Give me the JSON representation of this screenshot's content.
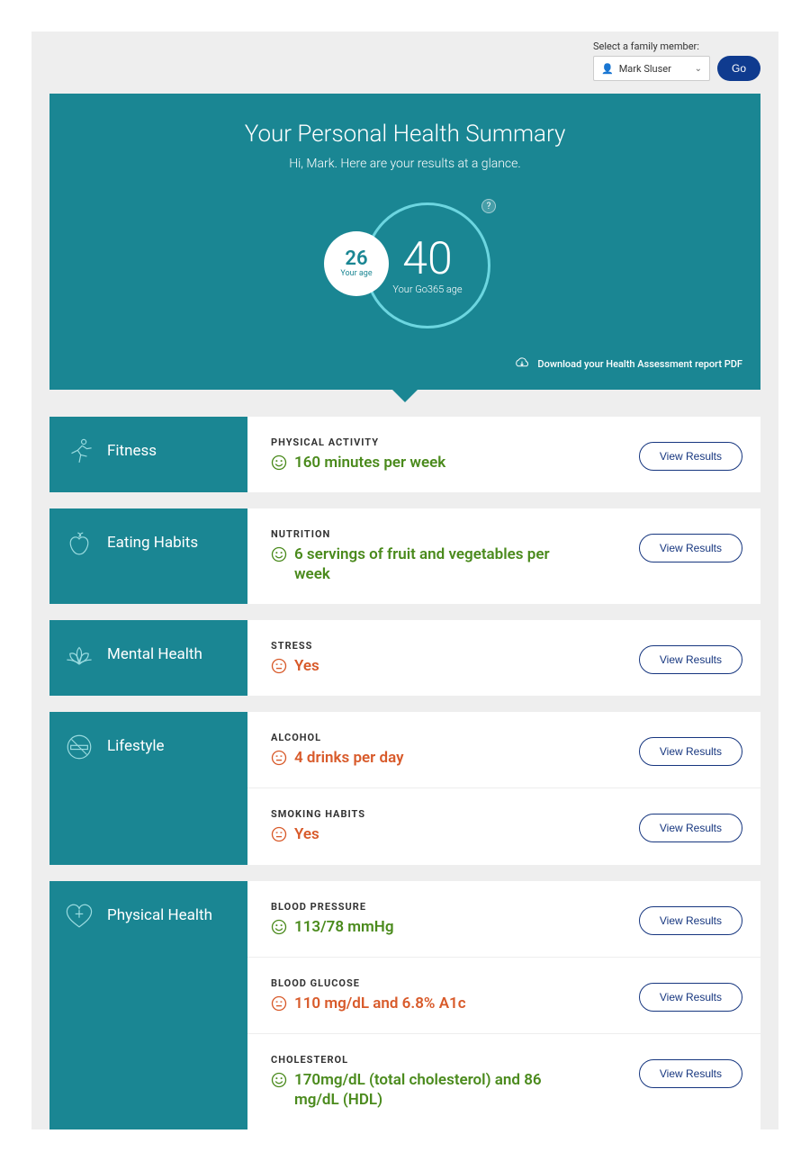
{
  "family": {
    "label": "Select a family member:",
    "selected": "Mark Sluser",
    "go_label": "Go"
  },
  "hero": {
    "title": "Your Personal Health Summary",
    "subtitle": "Hi, Mark. Here are your results at a glance.",
    "your_age_value": "26",
    "your_age_label": "Your age",
    "go365_age_value": "40",
    "go365_age_label": "Your Go365 age",
    "help_glyph": "?",
    "download_label": "Download your Health Assessment report PDF"
  },
  "buttons": {
    "view_results": "View Results"
  },
  "sections": [
    {
      "icon": "runner",
      "label": "Fitness",
      "metrics": [
        {
          "title": "PHYSICAL ACTIVITY",
          "status": "good",
          "value": "160 minutes per week"
        }
      ]
    },
    {
      "icon": "apple",
      "label": "Eating Habits",
      "metrics": [
        {
          "title": "NUTRITION",
          "status": "good",
          "value": "6 servings of fruit and vegetables per week"
        }
      ]
    },
    {
      "icon": "lotus",
      "label": "Mental Health",
      "metrics": [
        {
          "title": "STRESS",
          "status": "bad",
          "value": "Yes"
        }
      ]
    },
    {
      "icon": "nosmoking",
      "label": "Lifestyle",
      "metrics": [
        {
          "title": "ALCOHOL",
          "status": "bad",
          "value": "4 drinks per day"
        },
        {
          "title": "SMOKING HABITS",
          "status": "bad",
          "value": "Yes"
        }
      ]
    },
    {
      "icon": "heartplus",
      "label": "Physical Health",
      "metrics": [
        {
          "title": "BLOOD PRESSURE",
          "status": "good",
          "value": "113/78 mmHg"
        },
        {
          "title": "BLOOD GLUCOSE",
          "status": "bad",
          "value": "110 mg/dL and 6.8% A1c"
        },
        {
          "title": "CHOLESTEROL",
          "status": "good",
          "value": "170mg/dL (total cholesterol) and 86 mg/dL (HDL)"
        }
      ]
    }
  ]
}
